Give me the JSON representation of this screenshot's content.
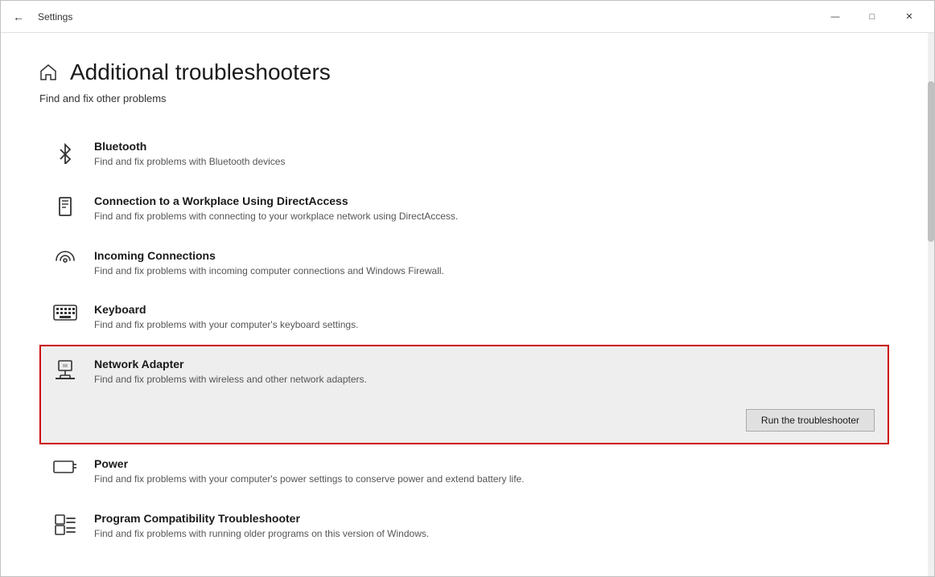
{
  "window": {
    "title": "Settings",
    "controls": {
      "minimize": "—",
      "maximize": "□",
      "close": "✕"
    }
  },
  "page": {
    "title": "Additional troubleshooters",
    "subtitle": "Find and fix other problems"
  },
  "troubleshooters": [
    {
      "id": "bluetooth",
      "title": "Bluetooth",
      "description": "Find and fix problems with Bluetooth devices",
      "icon": "bluetooth",
      "expanded": false
    },
    {
      "id": "directaccess",
      "title": "Connection to a Workplace Using DirectAccess",
      "description": "Find and fix problems with connecting to your workplace network using DirectAccess.",
      "icon": "workplace",
      "expanded": false
    },
    {
      "id": "incoming-connections",
      "title": "Incoming Connections",
      "description": "Find and fix problems with incoming computer connections and Windows Firewall.",
      "icon": "incoming",
      "expanded": false
    },
    {
      "id": "keyboard",
      "title": "Keyboard",
      "description": "Find and fix problems with your computer's keyboard settings.",
      "icon": "keyboard",
      "expanded": false
    },
    {
      "id": "network-adapter",
      "title": "Network Adapter",
      "description": "Find and fix problems with wireless and other network adapters.",
      "icon": "network",
      "expanded": true,
      "button_label": "Run the troubleshooter"
    },
    {
      "id": "power",
      "title": "Power",
      "description": "Find and fix problems with your computer's power settings to conserve power and extend battery life.",
      "icon": "power",
      "expanded": false
    },
    {
      "id": "program-compatibility",
      "title": "Program Compatibility Troubleshooter",
      "description": "Find and fix problems with running older programs on this version of Windows.",
      "icon": "program",
      "expanded": false
    }
  ]
}
